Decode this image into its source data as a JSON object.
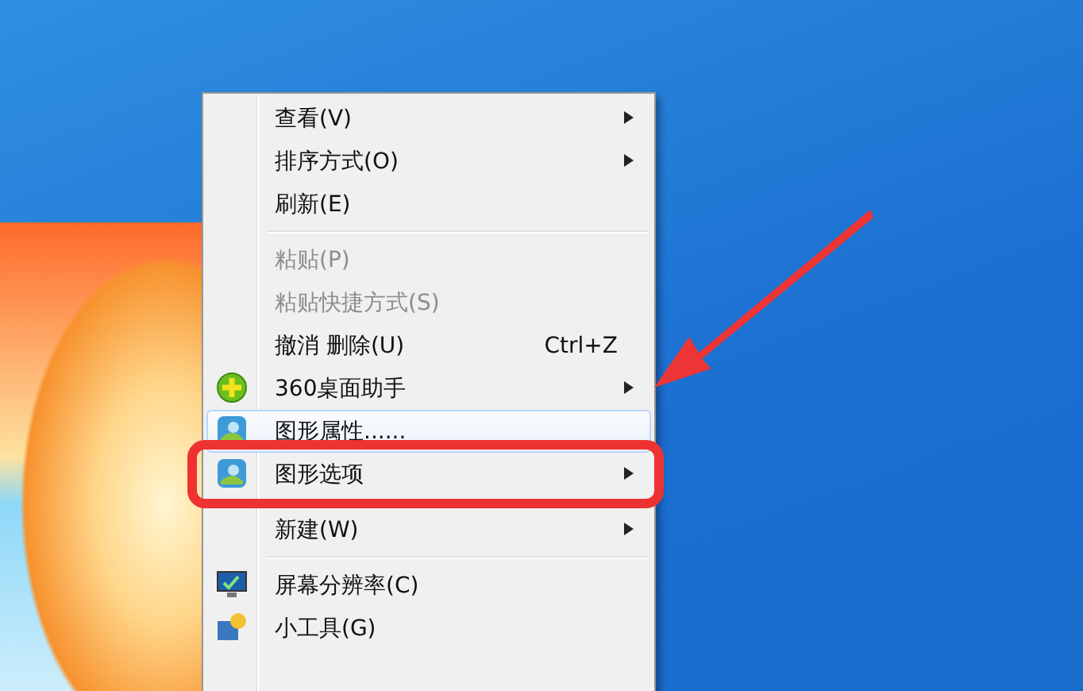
{
  "context_menu": {
    "sections": [
      [
        {
          "label": "查看(V)",
          "submenu": true,
          "disabled": false,
          "hovered": false,
          "highlighted": false
        },
        {
          "label": "排序方式(O)",
          "submenu": true,
          "disabled": false,
          "hovered": false,
          "highlighted": false
        },
        {
          "label": "刷新(E)",
          "submenu": false,
          "disabled": false,
          "hovered": false,
          "highlighted": false
        }
      ],
      [
        {
          "label": "粘贴(P)",
          "submenu": false,
          "disabled": true,
          "hovered": false,
          "highlighted": false
        },
        {
          "label": "粘贴快捷方式(S)",
          "submenu": false,
          "disabled": true,
          "hovered": false,
          "highlighted": false
        },
        {
          "label": "撤消 删除(U)",
          "shortcut": "Ctrl+Z",
          "submenu": false,
          "disabled": false,
          "hovered": false,
          "highlighted": false
        },
        {
          "label": "360桌面助手",
          "kind": "plus",
          "submenu": true,
          "disabled": false,
          "hovered": false,
          "highlighted": false
        },
        {
          "label": "图形属性......",
          "kind": "graphics",
          "submenu": false,
          "disabled": false,
          "hovered": true,
          "highlighted": false
        },
        {
          "label": "图形选项",
          "kind": "graphics",
          "submenu": true,
          "disabled": false,
          "hovered": false,
          "highlighted": true
        }
      ],
      [
        {
          "label": "新建(W)",
          "submenu": true,
          "disabled": false,
          "hovered": false,
          "highlighted": false
        }
      ],
      [
        {
          "label": "屏幕分辨率(C)",
          "kind": "monitor",
          "submenu": false,
          "disabled": false,
          "hovered": false,
          "highlighted": false
        },
        {
          "label": "小工具(G)",
          "kind": "gadget",
          "submenu": false,
          "disabled": false,
          "hovered": false,
          "highlighted": false
        }
      ]
    ]
  }
}
